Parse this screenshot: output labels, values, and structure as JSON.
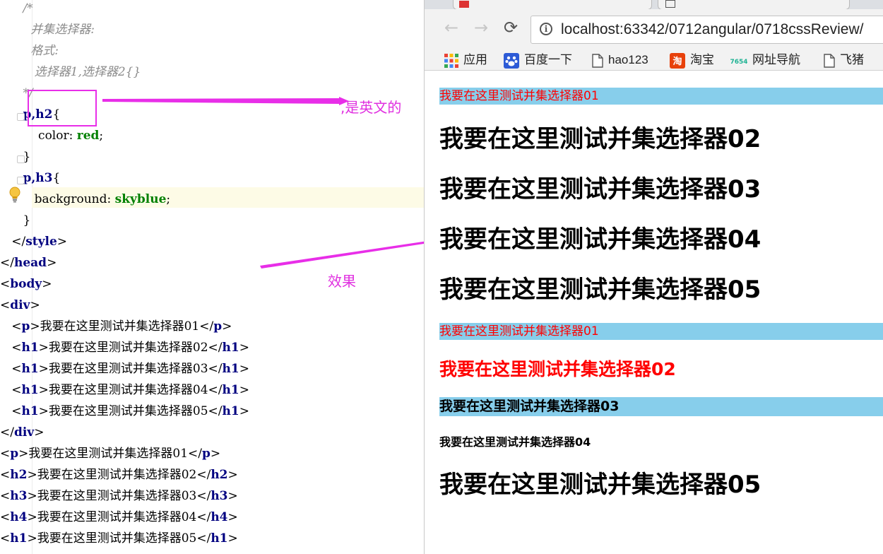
{
  "editor": {
    "lines": [
      {
        "indent": "      ",
        "parts": [
          {
            "c": "c-comment",
            "t": "/*"
          }
        ]
      },
      {
        "indent": "        ",
        "parts": [
          {
            "c": "c-comment",
            "t": "并集选择器:"
          }
        ]
      },
      {
        "indent": "        ",
        "parts": [
          {
            "c": "c-comment",
            "t": "格式:"
          }
        ]
      },
      {
        "indent": "         ",
        "parts": [
          {
            "c": "c-comment",
            "t": "选择器1,选择器2{}"
          }
        ]
      },
      {
        "indent": "      ",
        "parts": [
          {
            "c": "c-comment",
            "t": "*/"
          }
        ]
      },
      {
        "indent": "      ",
        "parts": [
          {
            "c": "c-sel",
            "t": "p,h2"
          },
          {
            "c": "c-br",
            "t": "{"
          }
        ]
      },
      {
        "indent": "          ",
        "parts": [
          {
            "c": "c-prop",
            "t": "color: "
          },
          {
            "c": "c-val",
            "t": "red"
          },
          {
            "c": "c-br",
            "t": ";"
          }
        ]
      },
      {
        "indent": "      ",
        "parts": [
          {
            "c": "c-br",
            "t": "}"
          }
        ]
      },
      {
        "indent": "      ",
        "parts": [
          {
            "c": "c-sel",
            "t": "p,h3"
          },
          {
            "c": "c-br",
            "t": "{"
          }
        ]
      },
      {
        "indent": "         ",
        "parts": [
          {
            "c": "c-prop",
            "t": "background: "
          },
          {
            "c": "c-val",
            "t": "skyblue"
          },
          {
            "c": "c-br",
            "t": ";"
          }
        ]
      },
      {
        "indent": "      ",
        "parts": [
          {
            "c": "c-br",
            "t": "}"
          }
        ]
      },
      {
        "indent": "   ",
        "parts": [
          {
            "c": "c-br",
            "t": "</"
          },
          {
            "c": "c-tag",
            "t": "style"
          },
          {
            "c": "c-br",
            "t": ">"
          }
        ]
      },
      {
        "indent": "",
        "parts": [
          {
            "c": "c-br",
            "t": "</"
          },
          {
            "c": "c-tag",
            "t": "head"
          },
          {
            "c": "c-br",
            "t": ">"
          }
        ]
      },
      {
        "indent": "",
        "parts": [
          {
            "c": "c-br",
            "t": "<"
          },
          {
            "c": "c-tag",
            "t": "body"
          },
          {
            "c": "c-br",
            "t": ">"
          }
        ]
      },
      {
        "indent": "",
        "parts": [
          {
            "c": "c-br",
            "t": "<"
          },
          {
            "c": "c-tag",
            "t": "div"
          },
          {
            "c": "c-br",
            "t": ">"
          }
        ]
      },
      {
        "indent": "   ",
        "parts": [
          {
            "c": "c-br",
            "t": "<"
          },
          {
            "c": "c-tag",
            "t": "p"
          },
          {
            "c": "c-br",
            "t": ">我要在这里测试并集选择器01</"
          },
          {
            "c": "c-tag",
            "t": "p"
          },
          {
            "c": "c-br",
            "t": ">"
          }
        ]
      },
      {
        "indent": "   ",
        "parts": [
          {
            "c": "c-br",
            "t": "<"
          },
          {
            "c": "c-tag",
            "t": "h1"
          },
          {
            "c": "c-br",
            "t": ">我要在这里测试并集选择器02</"
          },
          {
            "c": "c-tag",
            "t": "h1"
          },
          {
            "c": "c-br",
            "t": ">"
          }
        ]
      },
      {
        "indent": "   ",
        "parts": [
          {
            "c": "c-br",
            "t": "<"
          },
          {
            "c": "c-tag",
            "t": "h1"
          },
          {
            "c": "c-br",
            "t": ">我要在这里测试并集选择器03</"
          },
          {
            "c": "c-tag",
            "t": "h1"
          },
          {
            "c": "c-br",
            "t": ">"
          }
        ]
      },
      {
        "indent": "   ",
        "parts": [
          {
            "c": "c-br",
            "t": "<"
          },
          {
            "c": "c-tag",
            "t": "h1"
          },
          {
            "c": "c-br",
            "t": ">我要在这里测试并集选择器04</"
          },
          {
            "c": "c-tag",
            "t": "h1"
          },
          {
            "c": "c-br",
            "t": ">"
          }
        ]
      },
      {
        "indent": "   ",
        "parts": [
          {
            "c": "c-br",
            "t": "<"
          },
          {
            "c": "c-tag",
            "t": "h1"
          },
          {
            "c": "c-br",
            "t": ">我要在这里测试并集选择器05</"
          },
          {
            "c": "c-tag",
            "t": "h1"
          },
          {
            "c": "c-br",
            "t": ">"
          }
        ]
      },
      {
        "indent": "",
        "parts": [
          {
            "c": "c-br",
            "t": "</"
          },
          {
            "c": "c-tag",
            "t": "div"
          },
          {
            "c": "c-br",
            "t": ">"
          }
        ]
      },
      {
        "indent": "",
        "parts": [
          {
            "c": "c-br",
            "t": "<"
          },
          {
            "c": "c-tag",
            "t": "p"
          },
          {
            "c": "c-br",
            "t": ">我要在这里测试并集选择器01</"
          },
          {
            "c": "c-tag",
            "t": "p"
          },
          {
            "c": "c-br",
            "t": ">"
          }
        ]
      },
      {
        "indent": "",
        "parts": [
          {
            "c": "c-br",
            "t": "<"
          },
          {
            "c": "c-tag",
            "t": "h2"
          },
          {
            "c": "c-br",
            "t": ">我要在这里测试并集选择器02</"
          },
          {
            "c": "c-tag",
            "t": "h2"
          },
          {
            "c": "c-br",
            "t": ">"
          }
        ]
      },
      {
        "indent": "",
        "parts": [
          {
            "c": "c-br",
            "t": "<"
          },
          {
            "c": "c-tag",
            "t": "h3"
          },
          {
            "c": "c-br",
            "t": ">我要在这里测试并集选择器03</"
          },
          {
            "c": "c-tag",
            "t": "h3"
          },
          {
            "c": "c-br",
            "t": ">"
          }
        ]
      },
      {
        "indent": "",
        "parts": [
          {
            "c": "c-br",
            "t": "<"
          },
          {
            "c": "c-tag",
            "t": "h4"
          },
          {
            "c": "c-br",
            "t": ">我要在这里测试并集选择器04</"
          },
          {
            "c": "c-tag",
            "t": "h4"
          },
          {
            "c": "c-br",
            "t": ">"
          }
        ]
      },
      {
        "indent": "",
        "parts": [
          {
            "c": "c-br",
            "t": "<"
          },
          {
            "c": "c-tag",
            "t": "h1"
          },
          {
            "c": "c-br",
            "t": ">我要在这里测试并集选择器05</"
          },
          {
            "c": "c-tag",
            "t": "h1"
          },
          {
            "c": "c-br",
            "t": ">"
          }
        ]
      }
    ]
  },
  "annotations": {
    "english_comma_note": ",是英文的",
    "effect_note": "效果",
    "color": "#e82ee8"
  },
  "browser": {
    "url": "localhost:63342/0712angular/0718cssReview/",
    "info_icon": "info-icon",
    "bookmarks": [
      {
        "label": "应用",
        "icon": "apps-grid-icon"
      },
      {
        "label": "百度一下",
        "icon": "baidu-paw-icon"
      },
      {
        "label": "hao123",
        "icon": "page-icon"
      },
      {
        "label": "淘宝",
        "icon": "taobao-icon"
      },
      {
        "label": "网址导航",
        "icon": "7654-icon"
      },
      {
        "label": "飞猪",
        "icon": "page-icon"
      }
    ],
    "page": {
      "div_p": "我要在这里测试并集选择器01",
      "div_h1_02": "我要在这里测试并集选择器02",
      "div_h1_03": "我要在这里测试并集选择器03",
      "div_h1_04": "我要在这里测试并集选择器04",
      "div_h1_05": "我要在这里测试并集选择器05",
      "p": "我要在这里测试并集选择器01",
      "h2": "我要在这里测试并集选择器02",
      "h3": "我要在这里测试并集选择器03",
      "h4": "我要在这里测试并集选择器04",
      "h1": "我要在这里测试并集选择器05"
    },
    "colors": {
      "red": "#ff0000",
      "skyblue": "#87ceeb"
    }
  }
}
